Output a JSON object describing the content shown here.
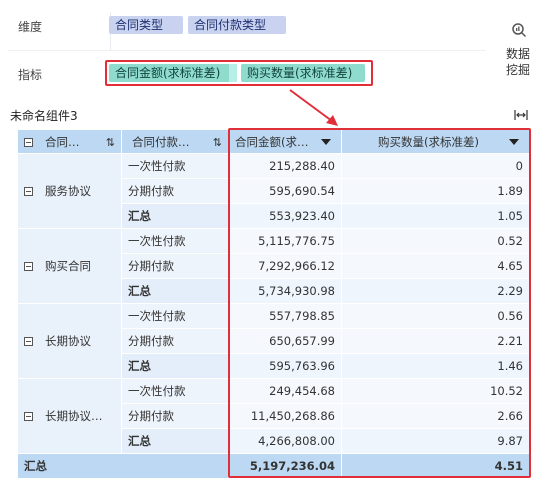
{
  "fields": {
    "dimension_label": "维度",
    "metric_label": "指标",
    "dimensions": [
      "合同类型",
      "合同付款类型"
    ],
    "metrics": [
      "合同金额(求标准差)",
      "购买数量(求标准差)"
    ]
  },
  "side_button": {
    "line1": "数据",
    "line2": "挖掘",
    "icon": "data-mining-icon"
  },
  "widget": {
    "title": "未命名组件3"
  },
  "table": {
    "headers": [
      "合同…",
      "合同付款…",
      "合同金额(求…",
      "购买数量(求标准差)"
    ],
    "groups": [
      {
        "name": "服务协议",
        "rows": [
          {
            "type": "一次性付款",
            "amount": "215,288.40",
            "qty": "0"
          },
          {
            "type": "分期付款",
            "amount": "595,690.54",
            "qty": "1.89"
          },
          {
            "type": "汇总",
            "amount": "553,923.40",
            "qty": "1.05"
          }
        ]
      },
      {
        "name": "购买合同",
        "rows": [
          {
            "type": "一次性付款",
            "amount": "5,115,776.75",
            "qty": "0.52"
          },
          {
            "type": "分期付款",
            "amount": "7,292,966.12",
            "qty": "4.65"
          },
          {
            "type": "汇总",
            "amount": "5,734,930.98",
            "qty": "2.29"
          }
        ]
      },
      {
        "name": "长期协议",
        "rows": [
          {
            "type": "一次性付款",
            "amount": "557,798.85",
            "qty": "0.56"
          },
          {
            "type": "分期付款",
            "amount": "650,657.99",
            "qty": "2.21"
          },
          {
            "type": "汇总",
            "amount": "595,763.96",
            "qty": "1.46"
          }
        ]
      },
      {
        "name": "长期协议…",
        "rows": [
          {
            "type": "一次性付款",
            "amount": "249,454.68",
            "qty": "10.52"
          },
          {
            "type": "分期付款",
            "amount": "11,450,268.86",
            "qty": "2.66"
          },
          {
            "type": "汇总",
            "amount": "4,266,808.00",
            "qty": "9.87"
          }
        ]
      }
    ],
    "total": {
      "label": "汇总",
      "amount": "5,197,236.04",
      "qty": "4.51"
    }
  },
  "colors": {
    "highlight": "#e12f3a",
    "header": "#bcd8f3",
    "dim_chip": "#c9d3f0",
    "metric_chip": "#8fdccf"
  }
}
